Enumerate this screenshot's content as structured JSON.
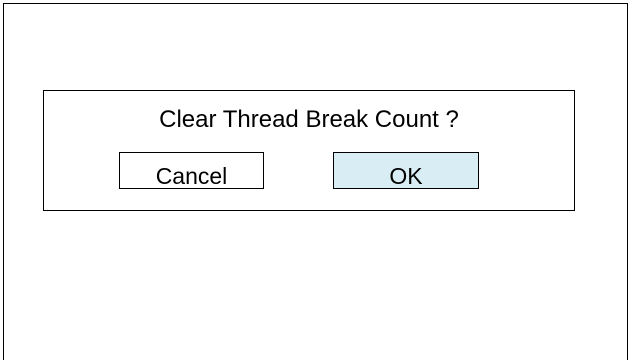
{
  "dialog": {
    "message": "Clear Thread Break Count ?",
    "cancel_label": "Cancel",
    "ok_label": "OK"
  },
  "colors": {
    "ok_button_background": "#d9eef4",
    "border": "#000000",
    "background": "#ffffff"
  }
}
